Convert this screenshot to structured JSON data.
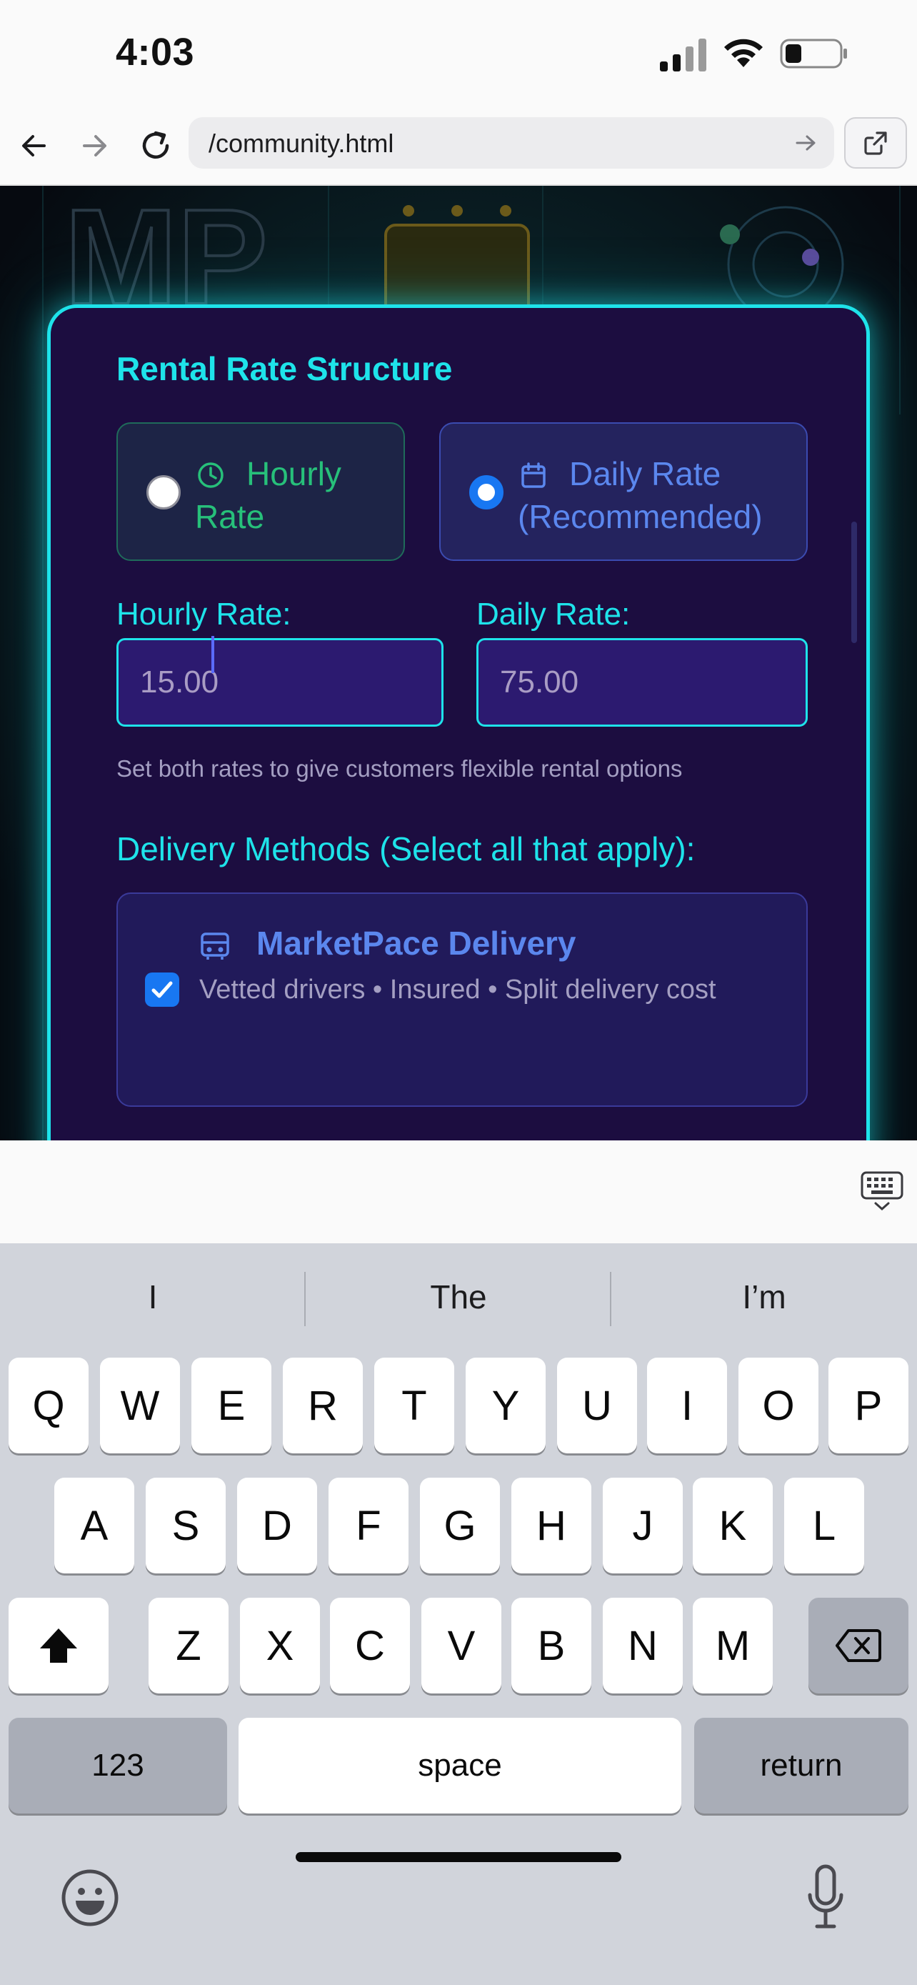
{
  "status_bar": {
    "time": "4:03"
  },
  "browser": {
    "url": "/community.html",
    "back_icon": "back-arrow-icon",
    "forward_icon": "forward-arrow-icon",
    "reload_icon": "reload-icon",
    "open_external_icon": "open-external-icon"
  },
  "rental": {
    "title": "Rental Rate Structure",
    "options": [
      {
        "label": "Hourly Rate",
        "icon": "clock-icon",
        "selected": false
      },
      {
        "label": "Daily Rate (Recommended)",
        "icon": "calendar-icon",
        "selected": true
      }
    ],
    "hourly_label": "Hourly Rate:",
    "hourly_value": "15.00",
    "daily_label": "Daily Rate:",
    "daily_value": "75.00",
    "hint": "Set both rates to give customers flexible rental options"
  },
  "delivery": {
    "title": "Delivery Methods (Select all that apply):",
    "methods": [
      {
        "name": "MarketPace Delivery",
        "description": "Vetted drivers • Insured • Split delivery cost",
        "checked": true,
        "icon": "delivery-truck-icon"
      }
    ]
  },
  "keyboard": {
    "suggestions": [
      "I",
      "The",
      "I’m"
    ],
    "rows": [
      [
        "Q",
        "W",
        "E",
        "R",
        "T",
        "Y",
        "U",
        "I",
        "O",
        "P"
      ],
      [
        "A",
        "S",
        "D",
        "F",
        "G",
        "H",
        "J",
        "K",
        "L"
      ],
      [
        "Z",
        "X",
        "C",
        "V",
        "B",
        "N",
        "M"
      ]
    ],
    "numbers_key": "123",
    "space_key": "space",
    "return_key": "return"
  },
  "colors": {
    "accent": "#1ee3ea",
    "card_bg": "#1c0d40",
    "selected_blue": "#1877f2",
    "hourly_green": "#27c07a"
  }
}
